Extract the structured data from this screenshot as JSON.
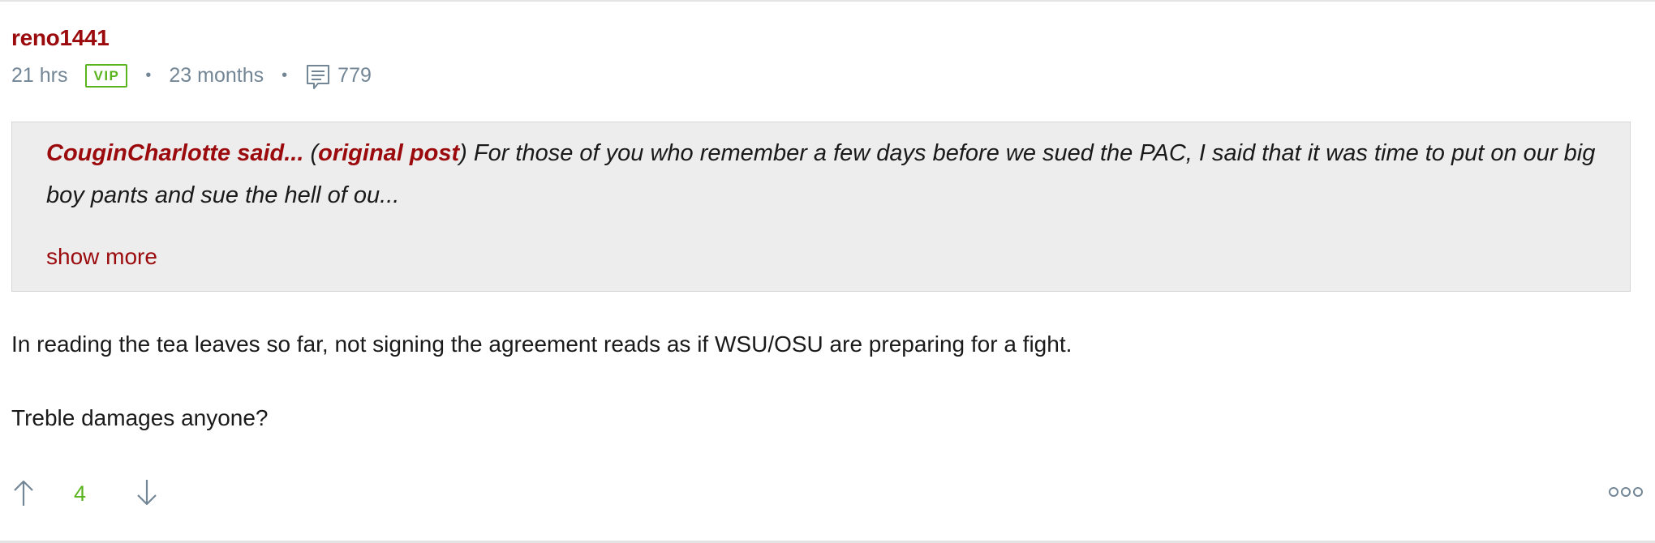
{
  "post": {
    "username": "reno1441",
    "posted_ago": "21 hrs",
    "badge": "VIP",
    "member_for": "23 months",
    "separator": "•",
    "post_count": "779",
    "quote": {
      "author": "CouginCharlotte said...",
      "open_paren": " (",
      "link_label": "original post",
      "close_paren": ")",
      "text": " For those of you who remember a few days before we sued the PAC, I said that it was time to put on our big boy pants and sue the hell of ou...",
      "show_more": "show more"
    },
    "body_lines": [
      "In reading the tea leaves so far, not signing the agreement reads as if WSU/OSU are preparing for a fight.",
      "Treble damages anyone?"
    ],
    "votes": {
      "score": "4",
      "up_icon": "arrow-up-icon",
      "down_icon": "arrow-down-icon"
    },
    "more_icon": "ellipsis-circles-icon"
  },
  "colors": {
    "brand": "#9b0a0d",
    "meta_gray": "#738696",
    "vip_green": "#5ab41e",
    "quote_bg": "#ededed"
  }
}
